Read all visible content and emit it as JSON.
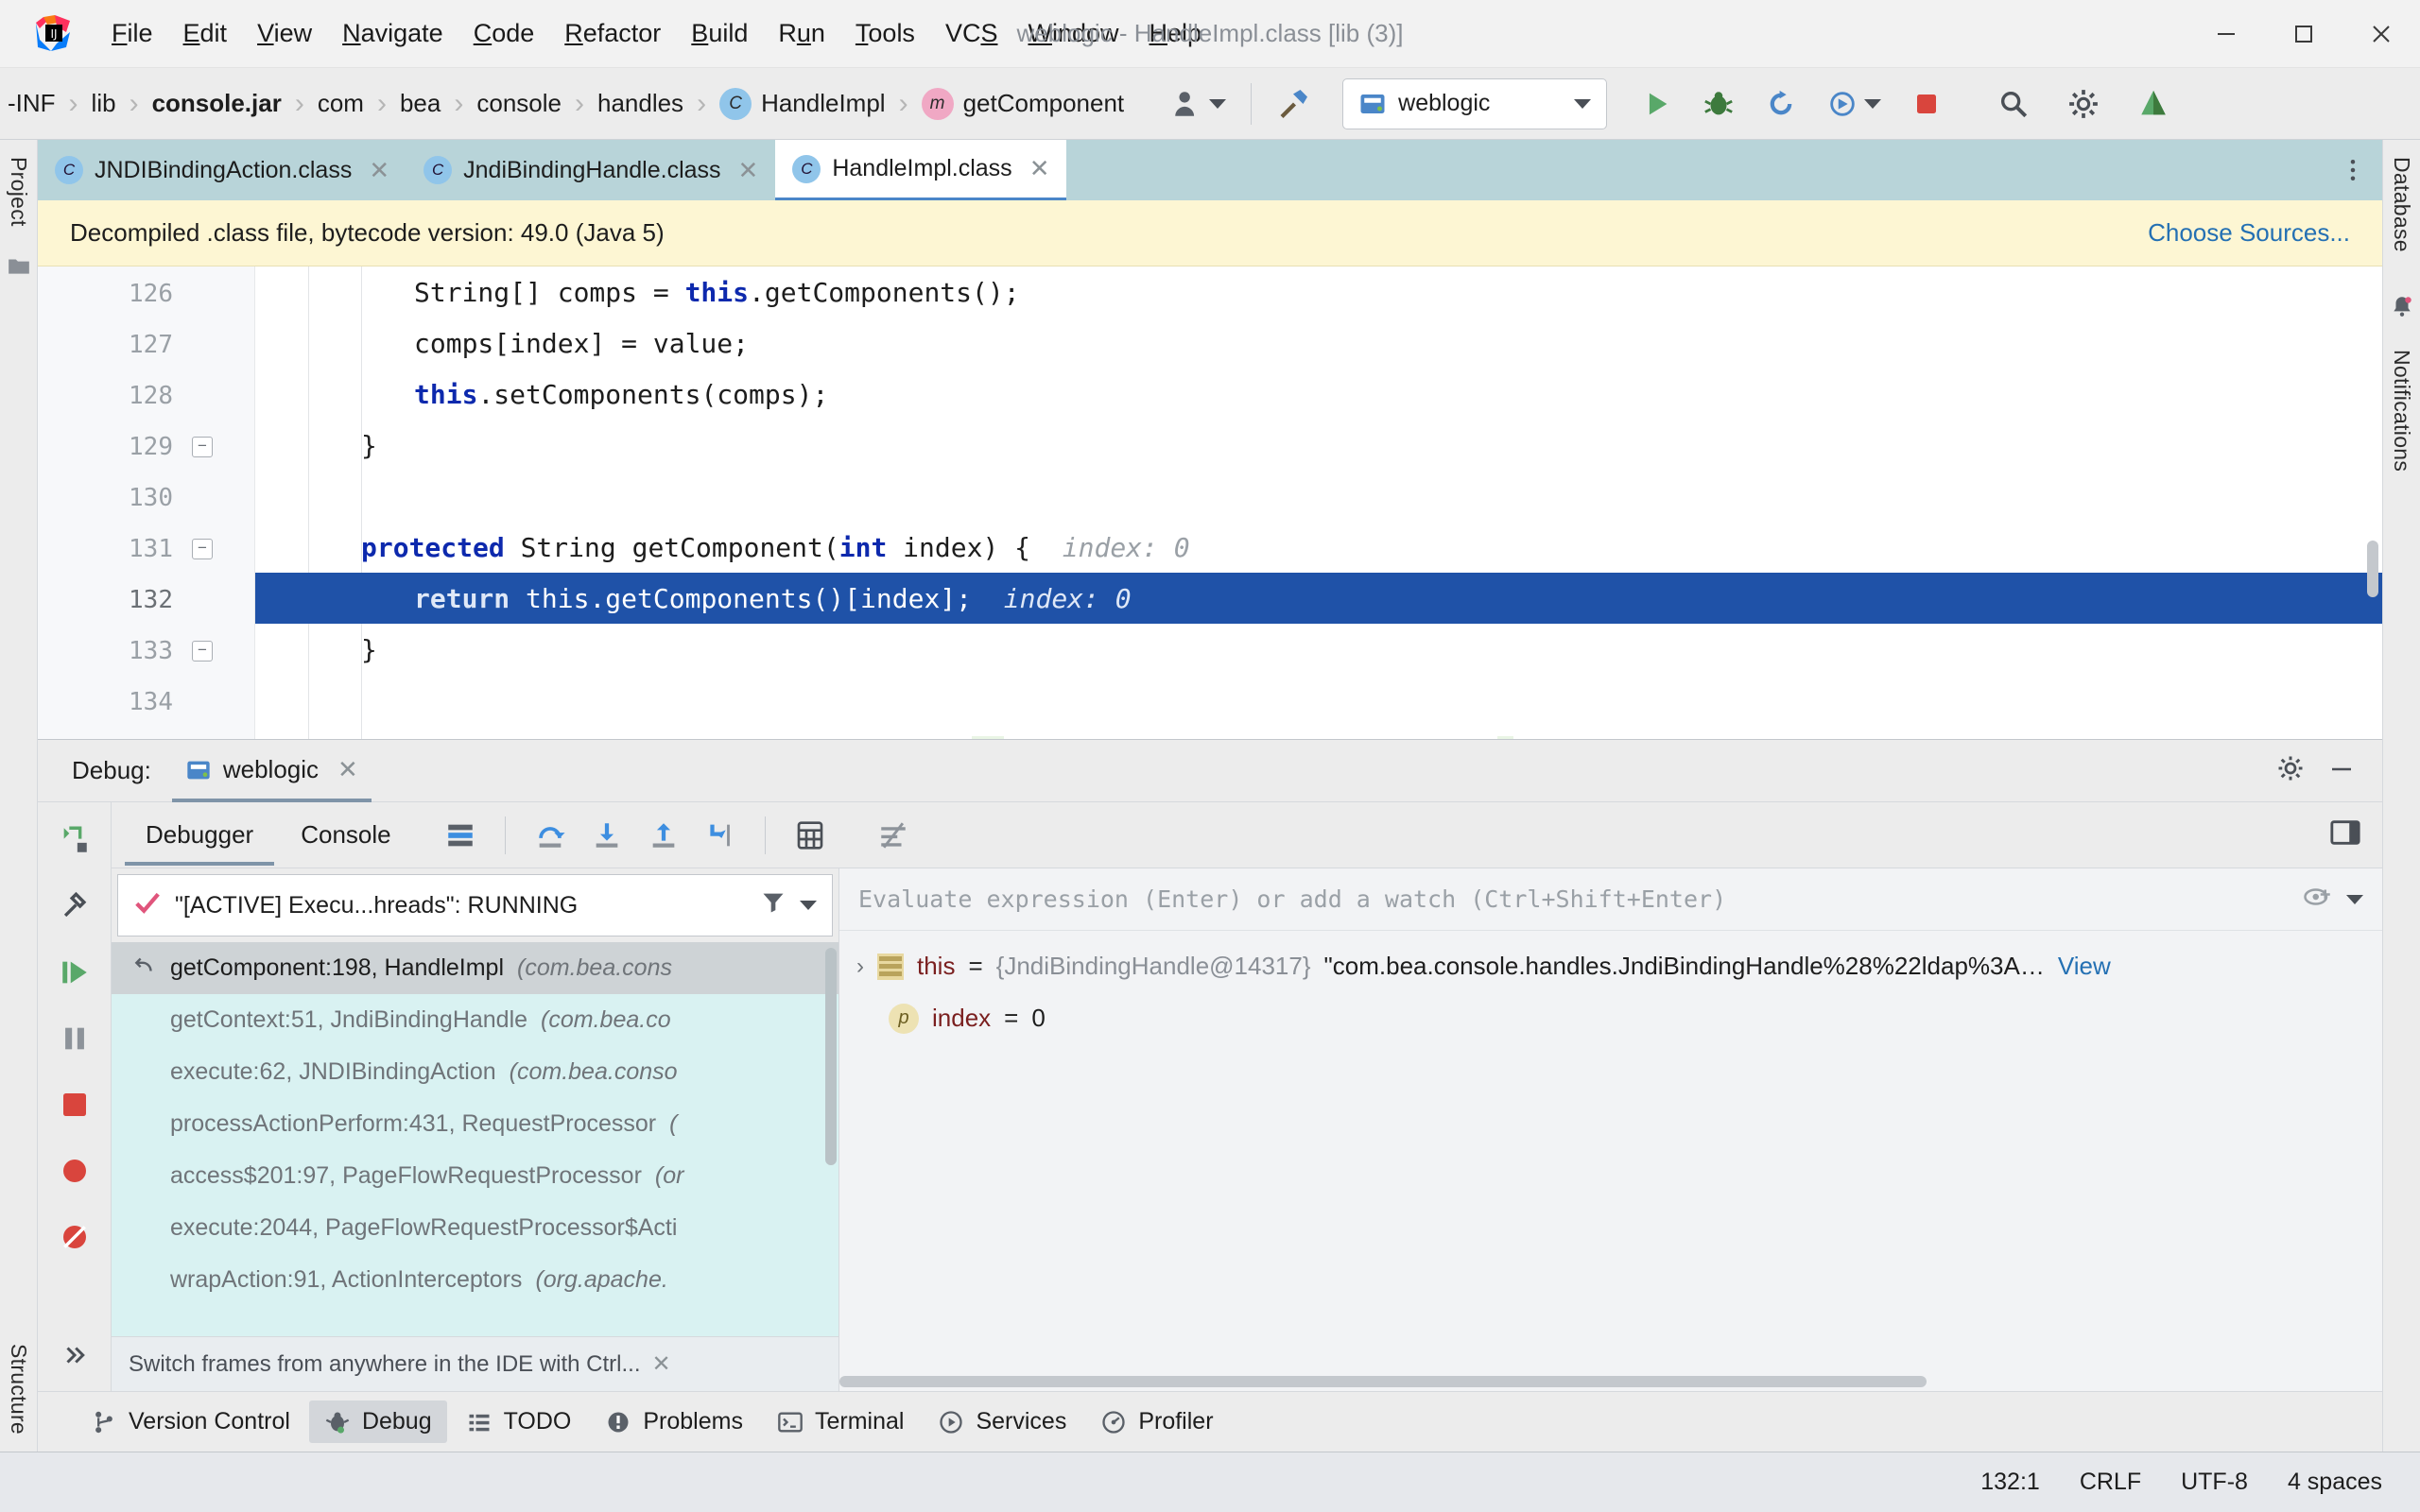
{
  "window": {
    "title": "weblogic - HandleImpl.class [lib (3)]",
    "logo_name": "intellij-idea-logo",
    "controls": [
      {
        "name": "minimize-button",
        "glyph": "─"
      },
      {
        "name": "maximize-button",
        "glyph": "☐"
      },
      {
        "name": "close-button",
        "glyph": "✕"
      }
    ]
  },
  "menubar": {
    "items": [
      {
        "label": "File",
        "mnemonic": "F"
      },
      {
        "label": "Edit",
        "mnemonic": "E"
      },
      {
        "label": "View",
        "mnemonic": "V"
      },
      {
        "label": "Navigate",
        "mnemonic": "N"
      },
      {
        "label": "Code",
        "mnemonic": "C"
      },
      {
        "label": "Refactor",
        "mnemonic": "R"
      },
      {
        "label": "Build",
        "mnemonic": "B"
      },
      {
        "label": "Run",
        "mnemonic": "u"
      },
      {
        "label": "Tools",
        "mnemonic": "T"
      },
      {
        "label": "VCS",
        "mnemonic": "S"
      },
      {
        "label": "Window",
        "mnemonic": "W"
      },
      {
        "label": "Help",
        "mnemonic": "H"
      }
    ]
  },
  "breadcrumb": {
    "items": [
      {
        "label": "-INF",
        "icon": null,
        "bold": false
      },
      {
        "label": "lib",
        "icon": null,
        "bold": false
      },
      {
        "label": "console.jar",
        "icon": null,
        "bold": true
      },
      {
        "label": "com",
        "icon": null,
        "bold": false
      },
      {
        "label": "bea",
        "icon": null,
        "bold": false
      },
      {
        "label": "console",
        "icon": null,
        "bold": false
      },
      {
        "label": "handles",
        "icon": null,
        "bold": false
      },
      {
        "label": "HandleImpl",
        "icon": "class-icon",
        "icon_letter": "C",
        "bold": false
      },
      {
        "label": "getComponent",
        "icon": "method-icon",
        "icon_letter": "m",
        "bold": false
      }
    ],
    "separator": "›"
  },
  "toolbar": {
    "account_icon": "user-account-icon",
    "build_icon": "hammer-build-icon",
    "run_config": {
      "name": "weblogic",
      "icon": "tomcat-server-icon"
    },
    "run_icon": "run-play-icon",
    "debug_icon": "debug-bug-icon",
    "rerun_icon": "rerun-icon",
    "coverage_icon": "run-coverage-icon",
    "stop_icon": "stop-square-icon",
    "search_icon": "search-magnifier-icon",
    "settings_icon": "gear-settings-icon",
    "updates_icon": "ide-updates-icon"
  },
  "rails": {
    "left_top": "Project",
    "left_bottom": "Structure",
    "right": [
      "Database",
      "Notifications"
    ]
  },
  "editor_tabs": {
    "tabs": [
      {
        "label": "JNDIBindingAction.class",
        "icon_letter": "C",
        "active": false
      },
      {
        "label": "JndiBindingHandle.class",
        "icon_letter": "C",
        "active": false
      },
      {
        "label": "HandleImpl.class",
        "icon_letter": "C",
        "active": true
      }
    ],
    "overflow_icon": "more-options-icon",
    "close_glyph": "✕"
  },
  "notification": {
    "message": "Decompiled .class file, bytecode version: 49.0 (Java 5)",
    "action": "Choose Sources..."
  },
  "editor": {
    "lines": [
      {
        "num": "126",
        "indent": 2,
        "fold": false,
        "current": false,
        "segments": [
          {
            "t": "String[] comps = ",
            "c": "plain"
          },
          {
            "t": "this",
            "c": "kw"
          },
          {
            "t": ".getComponents();",
            "c": "plain"
          }
        ]
      },
      {
        "num": "127",
        "indent": 2,
        "fold": false,
        "current": false,
        "segments": [
          {
            "t": "comps[index] = value;",
            "c": "plain"
          }
        ]
      },
      {
        "num": "128",
        "indent": 2,
        "fold": false,
        "current": false,
        "segments": [
          {
            "t": "this",
            "c": "kw"
          },
          {
            "t": ".setComponents(comps);",
            "c": "plain"
          }
        ]
      },
      {
        "num": "129",
        "indent": 1,
        "fold": true,
        "current": false,
        "segments": [
          {
            "t": "}",
            "c": "plain"
          }
        ]
      },
      {
        "num": "130",
        "indent": 0,
        "fold": false,
        "current": false,
        "segments": []
      },
      {
        "num": "131",
        "indent": 1,
        "fold": true,
        "current": false,
        "segments": [
          {
            "t": "protected ",
            "c": "kw"
          },
          {
            "t": "String getComponent(",
            "c": "plain"
          },
          {
            "t": "int",
            "c": "kw"
          },
          {
            "t": " index) {  ",
            "c": "plain"
          },
          {
            "t": "index: 0",
            "c": "hint"
          }
        ]
      },
      {
        "num": "132",
        "indent": 2,
        "fold": false,
        "current": true,
        "segments": [
          {
            "t": "return ",
            "c": "kw"
          },
          {
            "t": "this.getComponents()[index];  ",
            "c": "plain"
          },
          {
            "t": "index: 0",
            "c": "hint"
          }
        ]
      },
      {
        "num": "133",
        "indent": 1,
        "fold": true,
        "current": false,
        "segments": [
          {
            "t": "}",
            "c": "plain"
          }
        ]
      },
      {
        "num": "134",
        "indent": 0,
        "fold": false,
        "current": false,
        "segments": []
      }
    ]
  },
  "debug": {
    "panel_title": "Debug:",
    "run_tab": "weblogic",
    "run_tab_close": "✕",
    "settings_icon": "gear-settings-icon",
    "minimize_icon": "minimize-panel-icon",
    "tabs": [
      {
        "label": "Debugger",
        "active": true
      },
      {
        "label": "Console",
        "active": false
      }
    ],
    "toolbar_icons": [
      "layout-settings-icon",
      "step-over-icon",
      "step-into-icon",
      "step-out-icon",
      "force-step-into-icon",
      "evaluate-expression-icon",
      "mute-breakpoints-icon"
    ],
    "rail_icons": [
      "rerun-debug-icon",
      "debug-settings-icon",
      "resume-program-icon",
      "pause-program-icon",
      "stop-program-icon",
      "view-breakpoints-icon",
      "mute-breakpoints-rail-icon",
      "more-rail-icon"
    ],
    "layout_icon": "restore-layout-icon",
    "thread": {
      "status_icon": "thread-running-check-icon",
      "label": "\"[ACTIVE] Execu...hreads\": RUNNING",
      "filter_icon": "filter-funnel-icon",
      "dropdown_icon": "chevron-down-icon"
    },
    "frames": [
      {
        "method": "getComponent:198, HandleImpl",
        "pkg": "(com.bea.cons",
        "selected": true
      },
      {
        "method": "getContext:51, JndiBindingHandle",
        "pkg": "(com.bea.co",
        "selected": false
      },
      {
        "method": "execute:62, JNDIBindingAction",
        "pkg": "(com.bea.conso",
        "selected": false
      },
      {
        "method": "processActionPerform:431, RequestProcessor",
        "pkg": "(",
        "selected": false
      },
      {
        "method": "access$201:97, PageFlowRequestProcessor",
        "pkg": "(or",
        "selected": false
      },
      {
        "method": "execute:2044, PageFlowRequestProcessor$Acti",
        "pkg": "",
        "selected": false
      },
      {
        "method": "wrapAction:91, ActionInterceptors",
        "pkg": "(org.apache.",
        "selected": false
      }
    ],
    "frames_hint": {
      "text": "Switch frames from anywhere in the IDE with Ctrl...",
      "close": "✕"
    },
    "evaluate_placeholder": "Evaluate expression (Enter) or add a watch (Ctrl+Shift+Enter)",
    "watch_add_icon": "add-watch-icon",
    "watch_menu_icon": "chevron-down-icon",
    "variables": [
      {
        "expander": "›",
        "icon": "object-value-icon",
        "name": "this",
        "eq": " = ",
        "type": "{JndiBindingHandle@14317}",
        "value": "\"com.bea.console.handles.JndiBindingHandle%28%22ldap%3A…",
        "link": "View"
      },
      {
        "expander": "",
        "icon": "primitive-value-icon",
        "icon_letter": "p",
        "name": "index",
        "eq": " = ",
        "type": "",
        "value": "0",
        "link": ""
      }
    ]
  },
  "toolwindows": [
    {
      "label": "Version Control",
      "icon": "branch-icon",
      "active": false
    },
    {
      "label": "Debug",
      "icon": "debug-bug-icon",
      "active": true
    },
    {
      "label": "TODO",
      "icon": "todo-list-icon",
      "active": false
    },
    {
      "label": "Problems",
      "icon": "problems-warning-icon",
      "active": false
    },
    {
      "label": "Terminal",
      "icon": "terminal-icon",
      "active": false
    },
    {
      "label": "Services",
      "icon": "services-play-icon",
      "active": false
    },
    {
      "label": "Profiler",
      "icon": "profiler-icon",
      "active": false
    }
  ],
  "statusbar": {
    "caret": "132:1",
    "line_separator": "CRLF",
    "encoding": "UTF-8",
    "indent": "4 spaces"
  },
  "colors": {
    "accent_blue": "#1f52a8",
    "tab_bg": "#b8d4d9",
    "frames_bg": "#d9f2f2",
    "notif_bg": "#fdf6d3",
    "link": "#2470b3"
  }
}
